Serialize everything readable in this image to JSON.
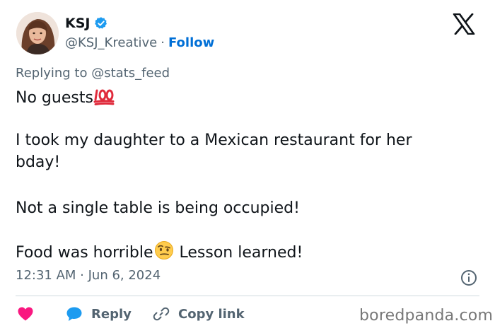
{
  "user": {
    "display_name": "KSJ",
    "handle": "@KSJ_Kreative",
    "separator": "·",
    "follow_label": "Follow",
    "verified_icon": "verified-badge-icon",
    "avatar_icon": "profile-photo"
  },
  "platform_logo": "x-logo-icon",
  "reply_context": "Replying to @stats_feed",
  "tweet": {
    "lines": [
      "No guests",
      "I took my daughter to a Mexican restaurant for her",
      "bday!",
      "Not a single table is being occupied!",
      "Food was horrible",
      " Lesson learned!"
    ],
    "emojis": [
      "hundred-points-emoji",
      "face-with-raised-eyebrow-emoji"
    ]
  },
  "timestamp": "12:31 AM · Jun 6, 2024",
  "actions": {
    "like_icon": "heart-icon",
    "reply_label": "Reply",
    "copy_link_label": "Copy link"
  },
  "watermark": "boredpanda.com",
  "colors": {
    "link": "#006fd6",
    "verified": "#1d9bf0",
    "like": "#f91880",
    "muted": "#536471",
    "text": "#0f1419",
    "divider": "#cfd9de"
  }
}
